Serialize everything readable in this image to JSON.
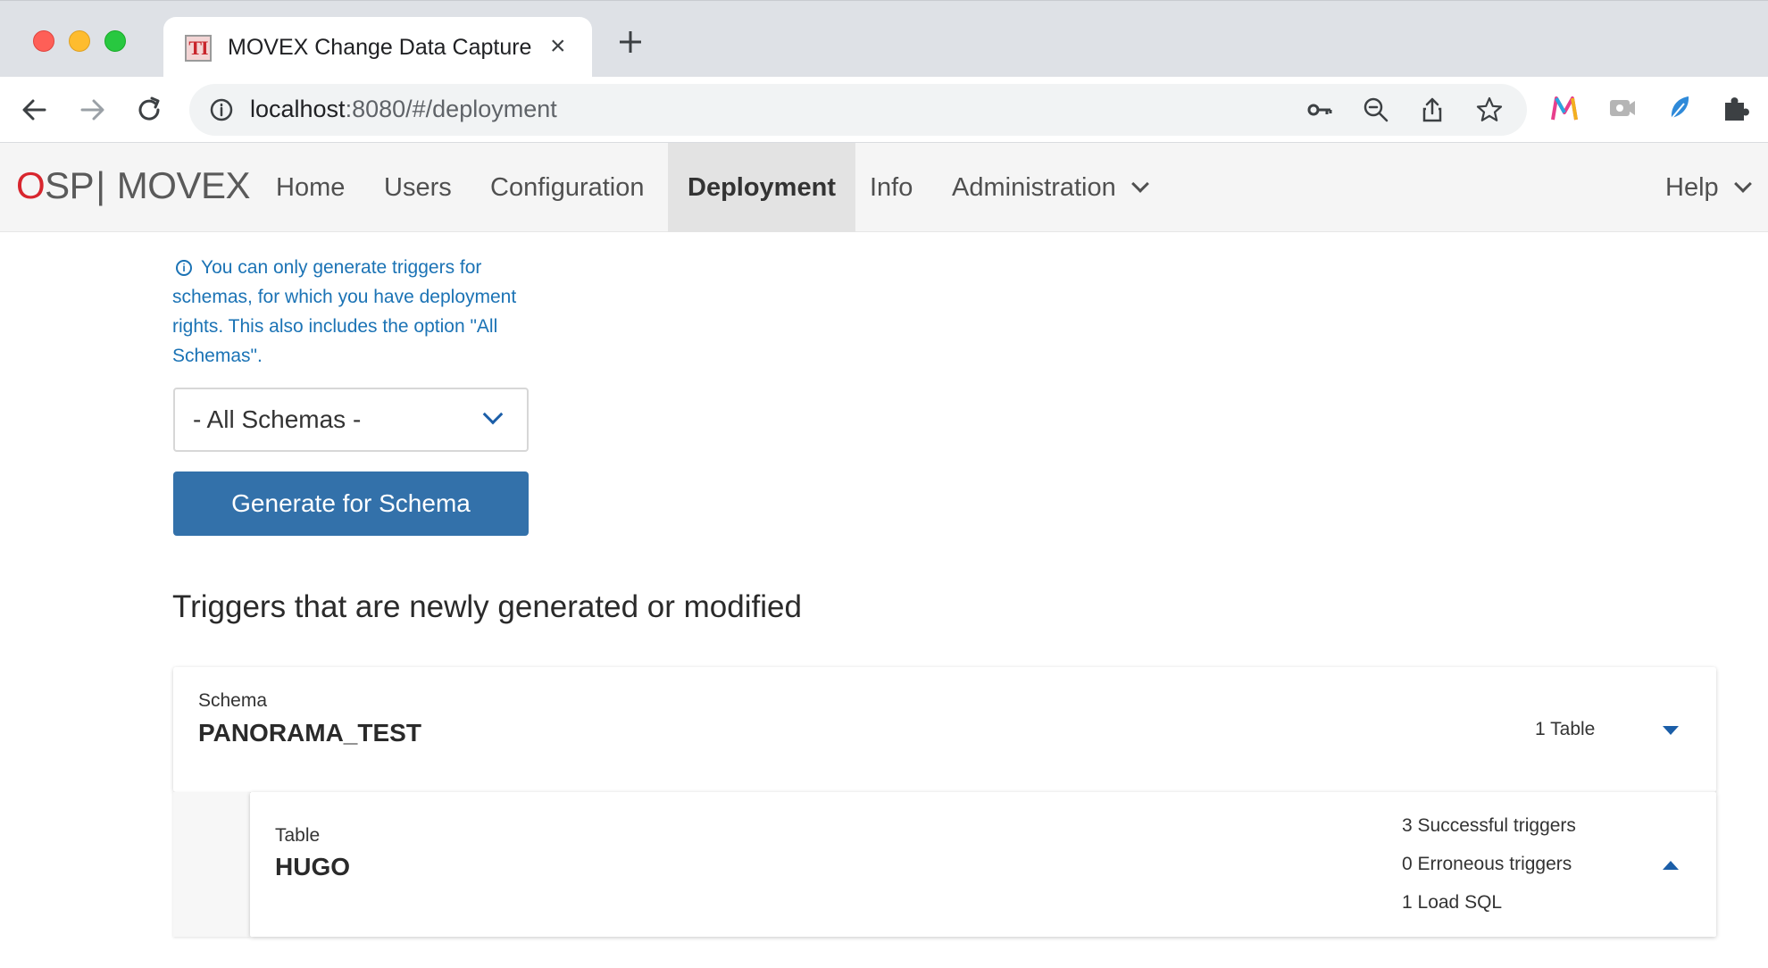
{
  "browser": {
    "tab_title": "MOVEX Change Data Capture",
    "tab_favicon_text": "TI",
    "tab_close": "×",
    "url_host": "localhost",
    "url_path": ":8080/#/deployment",
    "icons": [
      "back-arrow-icon",
      "forward-arrow-icon",
      "reload-icon",
      "info-icon",
      "key-icon",
      "zoom-out-icon",
      "share-icon",
      "star-icon",
      "movex-extension-icon",
      "camera-extension-icon",
      "feather-extension-icon",
      "puzzle-extensions-icon"
    ]
  },
  "navbar": {
    "brand_o": "O",
    "brand_sp": "SP",
    "brand_sep": "|",
    "brand_movex": " MOVEX",
    "items": [
      {
        "label": "Home"
      },
      {
        "label": "Users"
      },
      {
        "label": "Configuration"
      },
      {
        "label": "Deployment",
        "active": true
      },
      {
        "label": "Info"
      },
      {
        "label": "Administration"
      }
    ],
    "help": "Help"
  },
  "content": {
    "info_note": "You can only generate triggers for schemas, for which you have deployment rights. This also includes the option \"All Schemas\".",
    "schema_select_value": "- All Schemas -",
    "generate_button": "Generate for Schema",
    "section_title": "Triggers that are newly generated or modified",
    "schema_card": {
      "label": "Schema",
      "name": "PANORAMA_TEST",
      "count": "1 Table"
    },
    "table_card": {
      "label": "Table",
      "name": "HUGO",
      "successful": "3 Successful triggers",
      "erroneous": "0 Erroneous triggers",
      "load_sql": "1 Load SQL"
    }
  },
  "colors": {
    "accent": "#3371aa",
    "link": "#1b73b5",
    "brand_red": "#d8262e"
  }
}
